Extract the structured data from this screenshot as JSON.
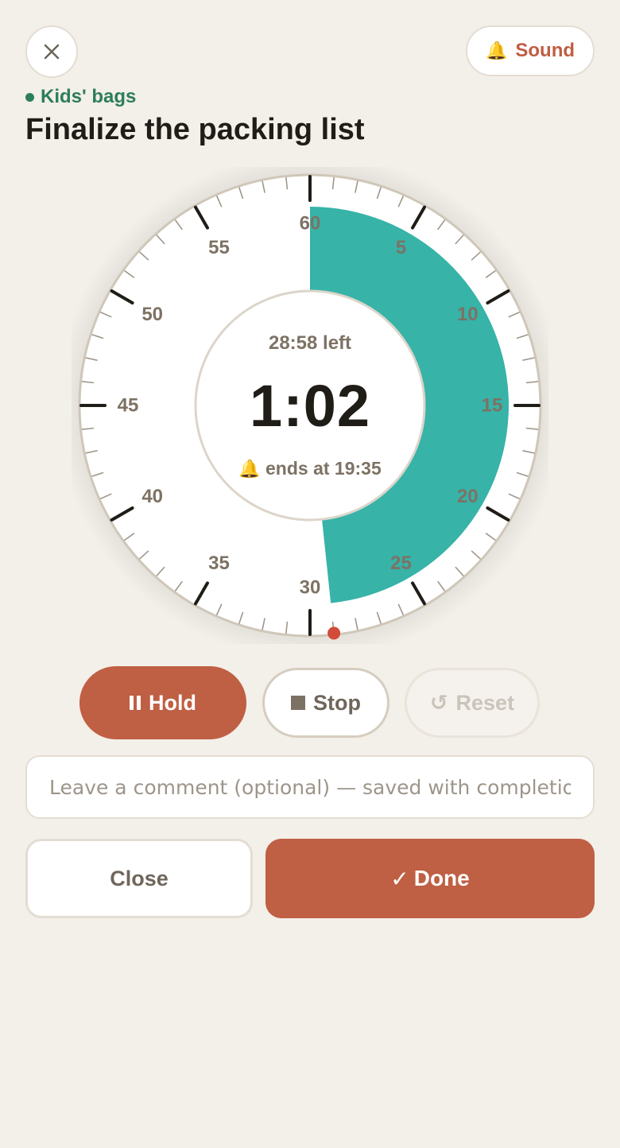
{
  "header": {
    "close_icon": "close-icon",
    "sound": {
      "icon": "bell-icon",
      "icon_glyph": "🔔",
      "label": "Sound"
    }
  },
  "task": {
    "category": "Kids' bags",
    "title": "Finalize the packing list"
  },
  "timer": {
    "dial_max_minutes": 60,
    "remaining_minutes": 29,
    "minute_labels": [
      "60",
      "5",
      "10",
      "15",
      "20",
      "25",
      "30",
      "35",
      "40",
      "45",
      "50",
      "55"
    ],
    "left_text": "28:58 left",
    "elapsed_text": "1:02",
    "ends_icon": "🔔",
    "ends_text": "ends at 19:35",
    "colors": {
      "fill": "#37b3a8",
      "marker": "#d24b3a",
      "face": "#ffffff",
      "ticks": "#201c17",
      "rim": "#cfc7b8"
    }
  },
  "controls": {
    "hold_label": "Hold",
    "stop_label": "Stop",
    "reset_glyph": "↺",
    "reset_label": "Reset"
  },
  "comment": {
    "placeholder": "Leave a comment (optional) — saved with completion"
  },
  "footer": {
    "close_label": "Close",
    "done_glyph": "✓",
    "done_label": "Done"
  },
  "colors": {
    "accent": "#bf5f43",
    "category": "#2e7d5b",
    "background": "#f3efe9"
  }
}
